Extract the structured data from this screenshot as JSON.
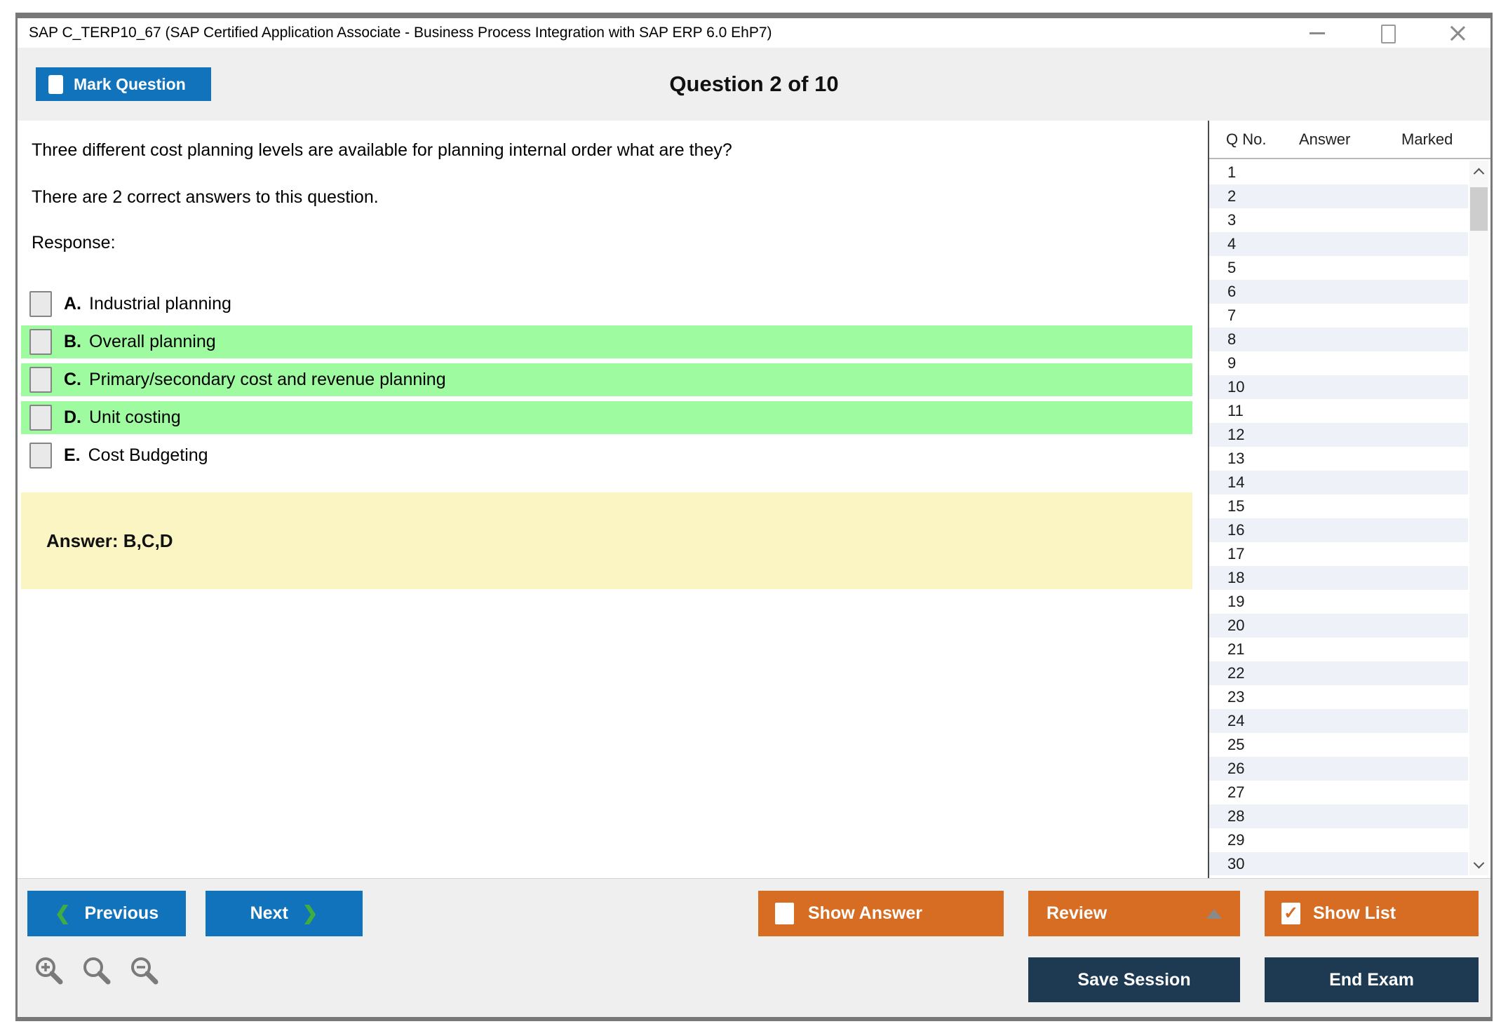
{
  "window": {
    "title": "SAP C_TERP10_67 (SAP Certified Application Associate - Business Process Integration with SAP ERP 6.0 EhP7)"
  },
  "header": {
    "mark_question_label": "Mark Question",
    "question_counter": "Question 2 of 10"
  },
  "question": {
    "text": "Three different cost planning levels are available for planning internal order what are they?",
    "instruction": "There are 2 correct answers to this question.",
    "response_label": "Response:",
    "options": [
      {
        "letter": "A.",
        "text": "Industrial planning",
        "highlighted": false,
        "checked": false
      },
      {
        "letter": "B.",
        "text": "Overall planning",
        "highlighted": true,
        "checked": false
      },
      {
        "letter": "C.",
        "text": "Primary/secondary cost and revenue planning",
        "highlighted": true,
        "checked": false
      },
      {
        "letter": "D.",
        "text": "Unit costing",
        "highlighted": true,
        "checked": false
      },
      {
        "letter": "E.",
        "text": "Cost Budgeting",
        "highlighted": false,
        "checked": false
      }
    ],
    "answer_text": "Answer: B,C,D"
  },
  "panel": {
    "headers": [
      "Q No.",
      "Answer",
      "Marked"
    ],
    "rows": [
      1,
      2,
      3,
      4,
      5,
      6,
      7,
      8,
      9,
      10,
      11,
      12,
      13,
      14,
      15,
      16,
      17,
      18,
      19,
      20,
      21,
      22,
      23,
      24,
      25,
      26,
      27,
      28,
      29,
      30
    ]
  },
  "toolbar": {
    "previous_label": "Previous",
    "next_label": "Next",
    "show_answer_label": "Show Answer",
    "review_label": "Review",
    "show_list_label": "Show List",
    "save_session_label": "Save Session",
    "end_exam_label": "End Exam"
  },
  "icons": {
    "prev_glyph": "❮",
    "next_glyph": "❯",
    "check_glyph": "✓",
    "minimize": "minus-icon",
    "maximize": "square-icon",
    "close": "x-icon",
    "review_expand": "triangle-up-icon",
    "zoom_set": [
      "magnifier-plus-icon",
      "magnifier-icon",
      "magnifier-minus-icon"
    ],
    "scrollbar": [
      "chevron-up-icon",
      "chevron-down-icon"
    ]
  },
  "colors": {
    "accent_blue": "#1173bc",
    "accent_orange": "#d66d23",
    "navy": "#1e3a52",
    "highlight_green": "#9efba0",
    "answer_yellow": "#faf5c3",
    "stripe_blue": "#eef2f8",
    "chevron_green": "#3fae3f",
    "header_gray": "#efefef"
  }
}
